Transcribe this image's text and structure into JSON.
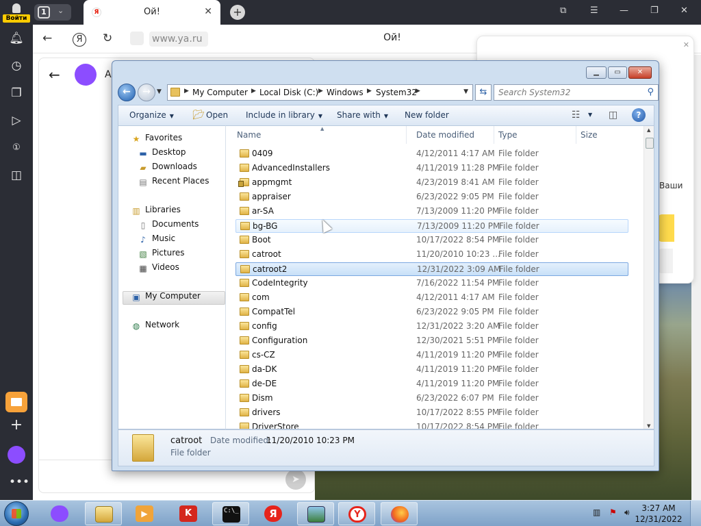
{
  "browser": {
    "rail": {
      "login_label": "Войти",
      "icons": [
        "bell-icon",
        "history-icon",
        "collections-icon",
        "play-icon",
        "one-icon",
        "camera-icon",
        "mail-icon",
        "plus-icon",
        "alice-icon",
        "more-icon"
      ]
    },
    "tab_count": "1",
    "tab_title": "Ой!",
    "favicon": "Я",
    "url": "www.ya.ru",
    "page_title": "Ой!",
    "page_header": "А",
    "popup_text": "Ваши"
  },
  "explorer": {
    "breadcrumb": [
      "My Computer",
      "Local Disk (C:)",
      "Windows",
      "System32"
    ],
    "search_placeholder": "Search System32",
    "toolbar": {
      "organize": "Organize",
      "open": "Open",
      "include_in_library": "Include in library",
      "share_with": "Share with",
      "new_folder": "New folder"
    },
    "nav": {
      "favorites": "Favorites",
      "desktop": "Desktop",
      "downloads": "Downloads",
      "recent_places": "Recent Places",
      "libraries": "Libraries",
      "documents": "Documents",
      "music": "Music",
      "pictures": "Pictures",
      "videos": "Videos",
      "my_computer": "My Computer",
      "network": "Network"
    },
    "columns": {
      "name": "Name",
      "date": "Date modified",
      "type": "Type",
      "size": "Size"
    },
    "files": [
      {
        "name": "0409",
        "date": "4/12/2011 4:17 AM",
        "type": "File folder",
        "state": ""
      },
      {
        "name": "AdvancedInstallers",
        "date": "4/11/2019 11:28 PM",
        "type": "File folder",
        "state": ""
      },
      {
        "name": "appmgmt",
        "date": "4/23/2019 8:41 AM",
        "type": "File folder",
        "state": "locked"
      },
      {
        "name": "appraiser",
        "date": "6/23/2022 9:05 PM",
        "type": "File folder",
        "state": ""
      },
      {
        "name": "ar-SA",
        "date": "7/13/2009 11:20 PM",
        "type": "File folder",
        "state": ""
      },
      {
        "name": "bg-BG",
        "date": "7/13/2009 11:20 PM",
        "type": "File folder",
        "state": "hover"
      },
      {
        "name": "Boot",
        "date": "10/17/2022 8:54 PM",
        "type": "File folder",
        "state": ""
      },
      {
        "name": "catroot",
        "date": "11/20/2010 10:23 ...",
        "type": "File folder",
        "state": ""
      },
      {
        "name": "catroot2",
        "date": "12/31/2022 3:09 AM",
        "type": "File folder",
        "state": "selected"
      },
      {
        "name": "CodeIntegrity",
        "date": "7/16/2022 11:54 PM",
        "type": "File folder",
        "state": ""
      },
      {
        "name": "com",
        "date": "4/12/2011 4:17 AM",
        "type": "File folder",
        "state": ""
      },
      {
        "name": "CompatTel",
        "date": "6/23/2022 9:05 PM",
        "type": "File folder",
        "state": ""
      },
      {
        "name": "config",
        "date": "12/31/2022 3:20 AM",
        "type": "File folder",
        "state": ""
      },
      {
        "name": "Configuration",
        "date": "12/30/2021 5:51 PM",
        "type": "File folder",
        "state": ""
      },
      {
        "name": "cs-CZ",
        "date": "4/11/2019 11:20 PM",
        "type": "File folder",
        "state": ""
      },
      {
        "name": "da-DK",
        "date": "4/11/2019 11:20 PM",
        "type": "File folder",
        "state": ""
      },
      {
        "name": "de-DE",
        "date": "4/11/2019 11:20 PM",
        "type": "File folder",
        "state": ""
      },
      {
        "name": "Dism",
        "date": "6/23/2022 6:07 PM",
        "type": "File folder",
        "state": ""
      },
      {
        "name": "drivers",
        "date": "10/17/2022 8:55 PM",
        "type": "File folder",
        "state": ""
      },
      {
        "name": "DriverStore",
        "date": "10/17/2022 8:54 PM",
        "type": "File folder",
        "state": ""
      }
    ],
    "details": {
      "name": "catroot",
      "date_label": "Date modified:",
      "date_value": "11/20/2010 10:23 PM",
      "type": "File folder"
    }
  },
  "taskbar": {
    "apps": [
      "explorer",
      "media-player",
      "kaspersky",
      "command-prompt",
      "yandex",
      "photos",
      "yandex-browser",
      "firefox"
    ],
    "kaspersky_label": "K",
    "yandex_label": "Я",
    "cmd_label": "C:\\_",
    "time": "3:27 AM",
    "date": "12/31/2022"
  }
}
